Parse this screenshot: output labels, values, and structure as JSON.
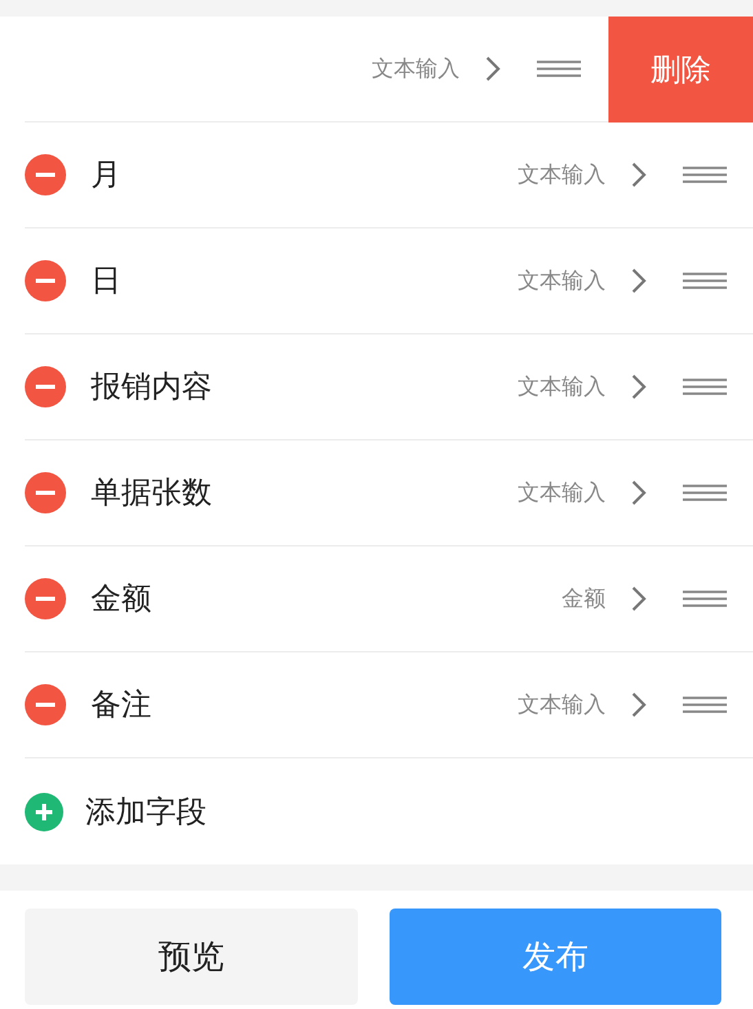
{
  "fields": [
    {
      "type_label": "文本输入",
      "swiped": true,
      "action": "删除"
    },
    {
      "name": "月",
      "type_label": "文本输入",
      "swiped": false
    },
    {
      "name": "日",
      "type_label": "文本输入",
      "swiped": false
    },
    {
      "name": "报销内容",
      "type_label": "文本输入",
      "swiped": false
    },
    {
      "name": "单据张数",
      "type_label": "文本输入",
      "swiped": false
    },
    {
      "name": "金额",
      "type_label": "金额",
      "swiped": false
    },
    {
      "name": "备注",
      "type_label": "文本输入",
      "swiped": false
    }
  ],
  "add_field": {
    "label": "添加字段"
  },
  "buttons": [
    {
      "label": "预览",
      "kind": "secondary"
    },
    {
      "label": "发布",
      "kind": "primary"
    }
  ]
}
